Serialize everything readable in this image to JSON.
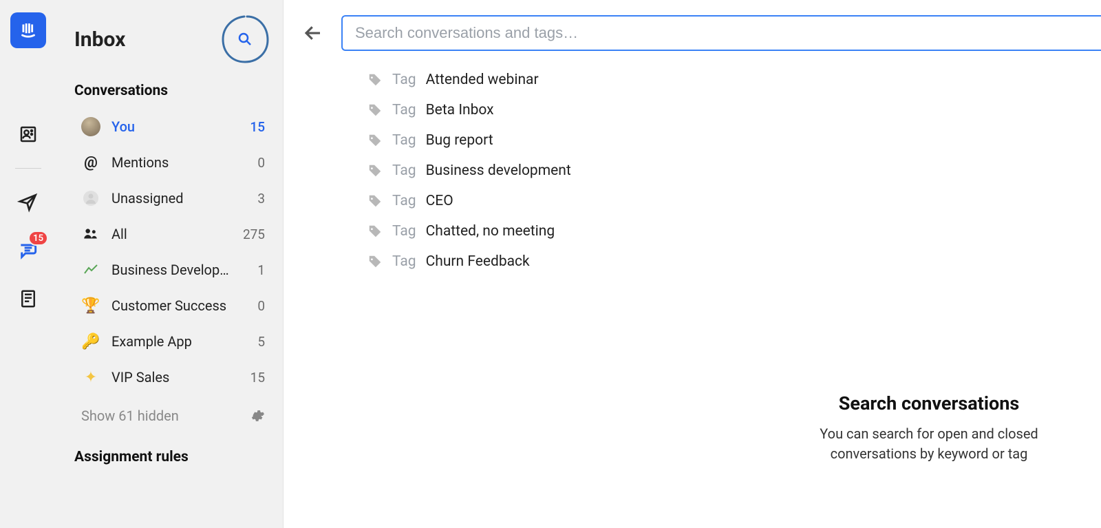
{
  "rail": {
    "inbox_badge": "15"
  },
  "sidebar": {
    "title": "Inbox",
    "section_label": "Conversations",
    "items": [
      {
        "label": "You",
        "count": "15",
        "icon": "avatar",
        "active": true
      },
      {
        "label": "Mentions",
        "count": "0",
        "icon": "at"
      },
      {
        "label": "Unassigned",
        "count": "3",
        "icon": "person"
      },
      {
        "label": "All",
        "count": "275",
        "icon": "people"
      },
      {
        "label": "Business Develop…",
        "count": "1",
        "icon": "chart"
      },
      {
        "label": "Customer Success",
        "count": "0",
        "icon": "trophy"
      },
      {
        "label": "Example App",
        "count": "5",
        "icon": "key"
      },
      {
        "label": "VIP Sales",
        "count": "15",
        "icon": "star"
      }
    ],
    "show_hidden_label": "Show 61 hidden",
    "rules_label": "Assignment rules"
  },
  "search": {
    "placeholder": "Search conversations and tags…",
    "tag_prefix": "Tag",
    "tags": [
      "Attended webinar",
      "Beta Inbox",
      "Bug report",
      "Business development",
      "CEO",
      "Chatted, no meeting",
      "Churn Feedback"
    ]
  },
  "empty": {
    "heading": "Search conversations",
    "body": "You can search for open and closed conversations by keyword or tag"
  }
}
